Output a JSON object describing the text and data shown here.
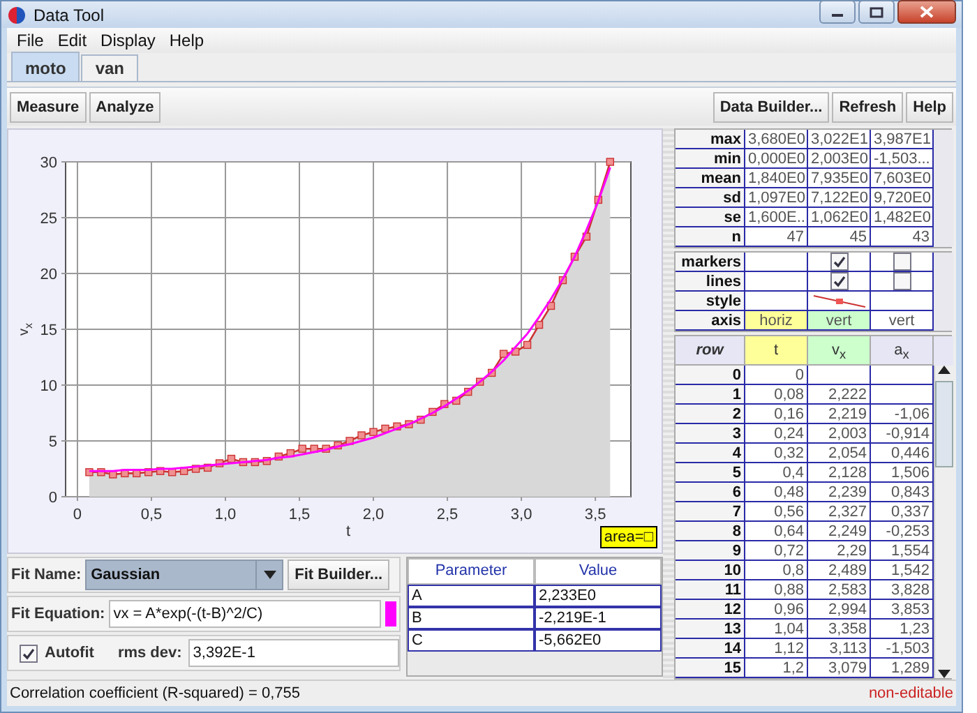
{
  "window": {
    "title": "Data Tool"
  },
  "menu": [
    "File",
    "Edit",
    "Display",
    "Help"
  ],
  "tabs": [
    {
      "label": "moto",
      "selected": true
    },
    {
      "label": "van",
      "selected": false
    }
  ],
  "toolbar": {
    "left_buttons": [
      "Measure",
      "Analyze"
    ],
    "right_buttons": [
      "Data Builder...",
      "Refresh",
      "Help"
    ]
  },
  "plot": {
    "area_label": "area=□",
    "chart_data": {
      "type": "area",
      "xlabel": "t",
      "ylabel": "v$_{x}$",
      "xlim": [
        -0.08,
        3.74
      ],
      "ylim": [
        0,
        30
      ],
      "grid": true,
      "xticks": [
        {
          "value": 0,
          "label": "0"
        },
        {
          "value": 0.5,
          "label": "0,5"
        },
        {
          "value": 1,
          "label": "1,0"
        },
        {
          "value": 1.5,
          "label": "1,5"
        },
        {
          "value": 2,
          "label": "2,0"
        },
        {
          "value": 2.5,
          "label": "2,5"
        },
        {
          "value": 3,
          "label": "3,0"
        },
        {
          "value": 3.5,
          "label": "3,5"
        }
      ],
      "yticks": [
        0,
        5,
        10,
        15,
        20,
        25,
        30
      ],
      "x": [
        0.08,
        0.16,
        0.24,
        0.32,
        0.4,
        0.48,
        0.56,
        0.64,
        0.72,
        0.8,
        0.88,
        0.96,
        1.04,
        1.12,
        1.2,
        1.28,
        1.36,
        1.44,
        1.52,
        1.6,
        1.68,
        1.76,
        1.84,
        1.92,
        2.0,
        2.08,
        2.16,
        2.24,
        2.32,
        2.4,
        2.48,
        2.56,
        2.64,
        2.72,
        2.8,
        2.88,
        2.96,
        3.04,
        3.12,
        3.2,
        3.28,
        3.36,
        3.44,
        3.52,
        3.6
      ],
      "series": [
        {
          "color": "#cc3333",
          "marker": "square",
          "values": [
            2.2,
            2.2,
            2.0,
            2.1,
            2.1,
            2.2,
            2.3,
            2.2,
            2.3,
            2.5,
            2.6,
            3.0,
            3.4,
            3.1,
            3.1,
            3.2,
            3.6,
            3.9,
            4.3,
            4.3,
            4.3,
            4.6,
            5.0,
            5.5,
            5.8,
            6.1,
            6.3,
            6.5,
            6.9,
            7.6,
            8.3,
            8.6,
            9.4,
            10.3,
            11.1,
            12.8,
            13.0,
            13.6,
            15.4,
            17.1,
            19.4,
            21.5,
            23.3,
            26.6,
            30.0
          ]
        },
        {
          "color": "#ff00ff",
          "type": "line",
          "values": [
            2.3,
            2.3,
            2.3,
            2.4,
            2.4,
            2.4,
            2.5,
            2.5,
            2.6,
            2.7,
            2.8,
            2.9,
            3.0,
            3.1,
            3.2,
            3.3,
            3.5,
            3.6,
            3.8,
            4.0,
            4.2,
            4.5,
            4.7,
            5.0,
            5.3,
            5.7,
            6.1,
            6.5,
            7.0,
            7.5,
            8.1,
            8.8,
            9.5,
            10.3,
            11.2,
            12.2,
            13.4,
            14.6,
            16.1,
            17.7,
            19.5,
            21.5,
            23.9,
            26.5,
            29.5
          ]
        }
      ]
    }
  },
  "fit": {
    "name_label": "Fit Name:",
    "name": "Gaussian",
    "builder_button": "Fit Builder...",
    "equation_label": "Fit Equation:",
    "equation": "vx = A*exp(-(t-B)^2/C)",
    "color": "#ff00ff",
    "autofit_label": "Autofit",
    "autofit": true,
    "rms_label": "rms dev:",
    "rms": "3,392E-1",
    "parameters": {
      "columns": [
        "Parameter",
        "Value"
      ],
      "rows": [
        [
          "A",
          "2,233E0"
        ],
        [
          "B",
          "-2,219E-1"
        ],
        [
          "C",
          "-5,662E0"
        ]
      ]
    }
  },
  "stats": [
    {
      "label": "max",
      "values": [
        "3,680E0",
        "3,022E1",
        "3,987E1"
      ]
    },
    {
      "label": "min",
      "values": [
        "0,000E0",
        "2,003E0",
        "-1,503..."
      ]
    },
    {
      "label": "mean",
      "values": [
        "1,840E0",
        "7,935E0",
        "7,603E0"
      ]
    },
    {
      "label": "sd",
      "values": [
        "1,097E0",
        "7,122E0",
        "9,720E0"
      ]
    },
    {
      "label": "se",
      "values": [
        "1,600E...",
        "1,062E0",
        "1,482E0"
      ]
    },
    {
      "label": "n",
      "values": [
        "47",
        "45",
        "43"
      ]
    }
  ],
  "display": {
    "row_labels": [
      "markers",
      "lines",
      "style",
      "axis"
    ],
    "columns": [
      {
        "axis": "horiz",
        "color": "#ffff99",
        "style_sample": false
      },
      {
        "markers": true,
        "lines": true,
        "style_sample": true,
        "axis": "vert",
        "color": "#ccffcc"
      },
      {
        "markers": false,
        "lines": false,
        "style_sample": false,
        "axis": "vert",
        "color": "#ffffff"
      }
    ]
  },
  "data_table": {
    "columns": [
      {
        "label": "row"
      },
      {
        "label": "t",
        "color": "#ffff99"
      },
      {
        "label": "v$_{x}$",
        "color": "#ccffcc"
      },
      {
        "label": "a$_{x}$",
        "color": "#e6e6f5"
      }
    ],
    "rows": [
      [
        "0",
        "0",
        null,
        null
      ],
      [
        "1",
        "0,08",
        "2,222",
        null
      ],
      [
        "2",
        "0,16",
        "2,219",
        "-1,06"
      ],
      [
        "3",
        "0,24",
        "2,003",
        "-0,914"
      ],
      [
        "4",
        "0,32",
        "2,054",
        "0,446"
      ],
      [
        "5",
        "0,4",
        "2,128",
        "1,506"
      ],
      [
        "6",
        "0,48",
        "2,239",
        "0,843"
      ],
      [
        "7",
        "0,56",
        "2,327",
        "0,337"
      ],
      [
        "8",
        "0,64",
        "2,249",
        "-0,253"
      ],
      [
        "9",
        "0,72",
        "2,29",
        "1,554"
      ],
      [
        "10",
        "0,8",
        "2,489",
        "1,542"
      ],
      [
        "11",
        "0,88",
        "2,583",
        "3,828"
      ],
      [
        "12",
        "0,96",
        "2,994",
        "3,853"
      ],
      [
        "13",
        "1,04",
        "3,358",
        "1,23"
      ],
      [
        "14",
        "1,12",
        "3,113",
        "-1,503"
      ],
      [
        "15",
        "1,2",
        "3,079",
        "1,289"
      ]
    ]
  },
  "status": {
    "message": "Correlation coefficient (R-squared) = 0,755",
    "mode": "non-editable"
  }
}
